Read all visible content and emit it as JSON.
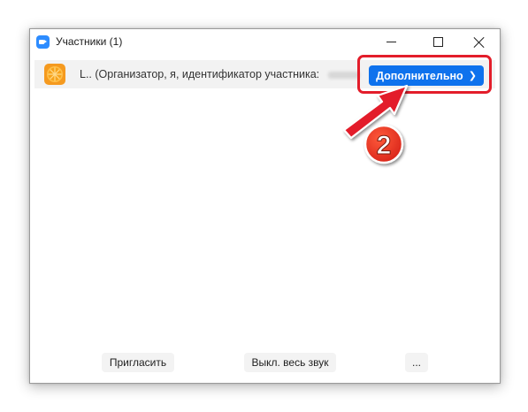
{
  "window": {
    "title": "Участники (1)"
  },
  "participant": {
    "name": "L.. (Организатор, я, идентификатор участника:",
    "more_label": "Дополнительно"
  },
  "annotation": {
    "step": "2"
  },
  "footer": {
    "invite_label": "Пригласить",
    "mute_all_label": "Выкл. весь звук",
    "more_label": "..."
  },
  "colors": {
    "accent": "#0e72ed",
    "annotation": "#e31d2a",
    "avatar": "#f59a1f"
  }
}
